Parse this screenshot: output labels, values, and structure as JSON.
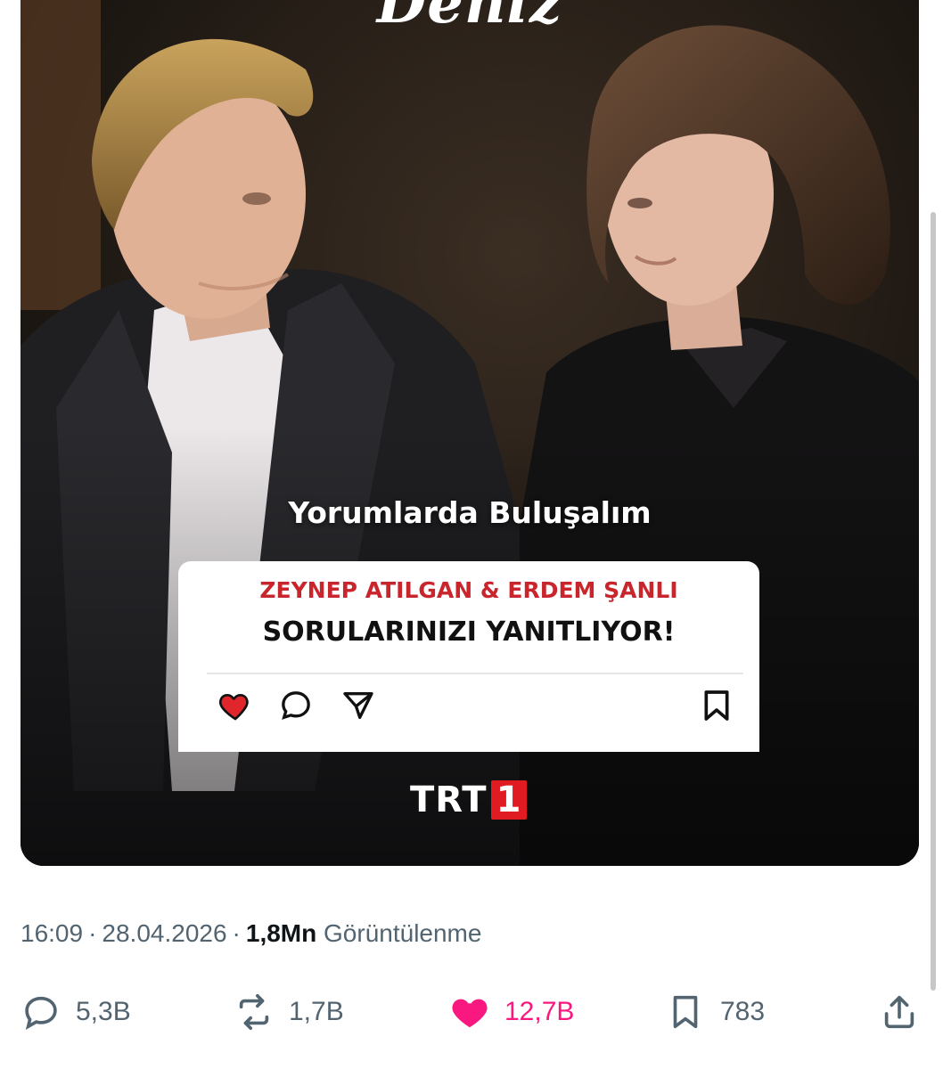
{
  "media": {
    "brand_title": "Deniz",
    "headline": "Yorumlarda Buluşalım",
    "card": {
      "names": "ZEYNEP ATILGAN & ERDEM ŞANLI",
      "subtitle": "SORULARINIZI YANITLIYOR!",
      "icons": [
        "heart-filled-icon",
        "comment-icon",
        "send-icon",
        "bookmark-icon"
      ]
    },
    "logo": {
      "text": "TRT",
      "number": "1"
    }
  },
  "meta": {
    "time": "16:09",
    "date": "28.04.2026",
    "views": "1,8Mn",
    "views_label": "Görüntülenme"
  },
  "actions": {
    "replies": "5,3B",
    "reposts": "1,7B",
    "likes": "12,7B",
    "bookmarks": "783"
  },
  "colors": {
    "accent_like": "#f91880",
    "text_secondary": "#536471",
    "text_primary": "#0f1419",
    "card_red": "#c8262c",
    "trt_red": "#e11b22"
  }
}
